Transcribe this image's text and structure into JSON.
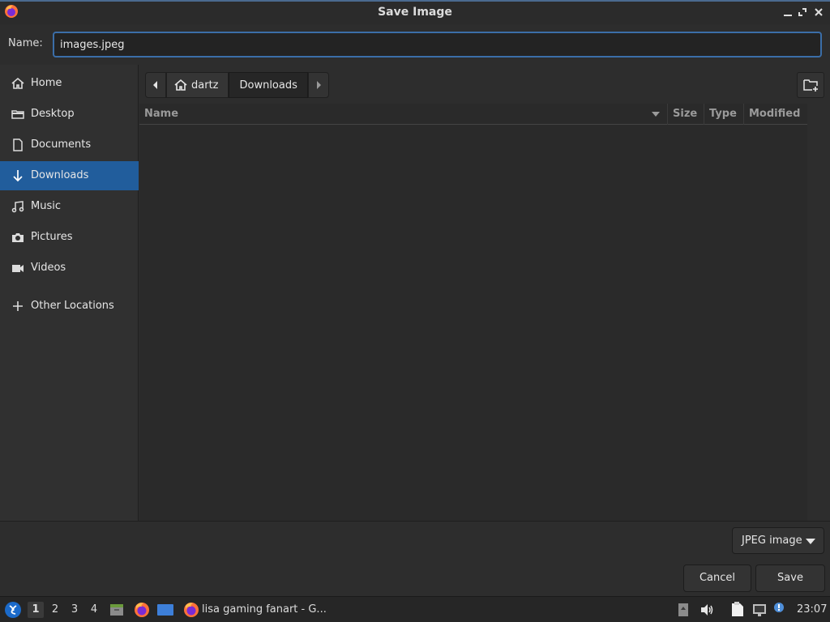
{
  "window": {
    "title": "Save Image"
  },
  "name_row": {
    "label": "Name:",
    "value": "images.jpeg"
  },
  "sidebar": {
    "items": [
      {
        "label": "Home",
        "icon": "home-icon"
      },
      {
        "label": "Desktop",
        "icon": "folder-icon"
      },
      {
        "label": "Documents",
        "icon": "document-icon"
      },
      {
        "label": "Downloads",
        "icon": "download-arrow-icon",
        "active": true
      },
      {
        "label": "Music",
        "icon": "music-icon"
      },
      {
        "label": "Pictures",
        "icon": "camera-icon"
      },
      {
        "label": "Videos",
        "icon": "video-icon"
      },
      {
        "label": "Other Locations",
        "icon": "plus-icon"
      }
    ]
  },
  "pathbar": {
    "segments": [
      "dartz",
      "Downloads"
    ]
  },
  "file_list": {
    "columns": [
      "Name",
      "Size",
      "Type",
      "Modified"
    ]
  },
  "bottom": {
    "filetype": "JPEG image",
    "cancel_label": "Cancel",
    "save_label": "Save"
  },
  "taskbar": {
    "workspaces": [
      "1",
      "2",
      "3",
      "4"
    ],
    "active_workspace": "1",
    "task_label": "lisa gaming fanart - G...",
    "clock": "23:07"
  },
  "colors": {
    "accent": "#215d9c",
    "focus_border": "#3b6ea8",
    "background": "#2d2d2d"
  }
}
